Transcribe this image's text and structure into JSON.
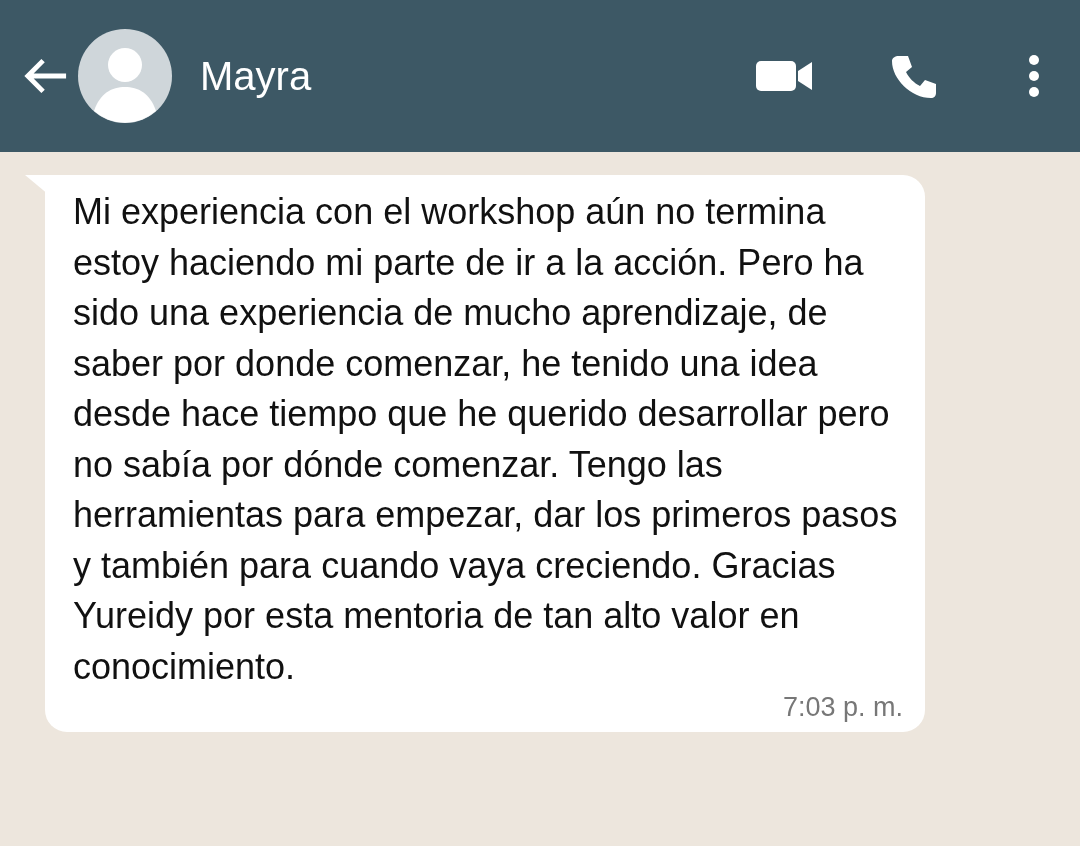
{
  "header": {
    "contact_name": "Mayra"
  },
  "message": {
    "text": "Mi experiencia con el workshop aún no termina estoy haciendo mi parte de ir a la acción. Pero ha sido una experiencia de mucho aprendizaje, de saber por donde comenzar, he tenido una idea desde hace tiempo que he querido desarrollar pero no sabía por dónde comenzar. Tengo las herramientas para empezar, dar los primeros pasos y también para cuando vaya creciendo. Gracias Yureidy por esta mentoria de tan alto valor en conocimiento.",
    "time": "7:03 p. m."
  }
}
